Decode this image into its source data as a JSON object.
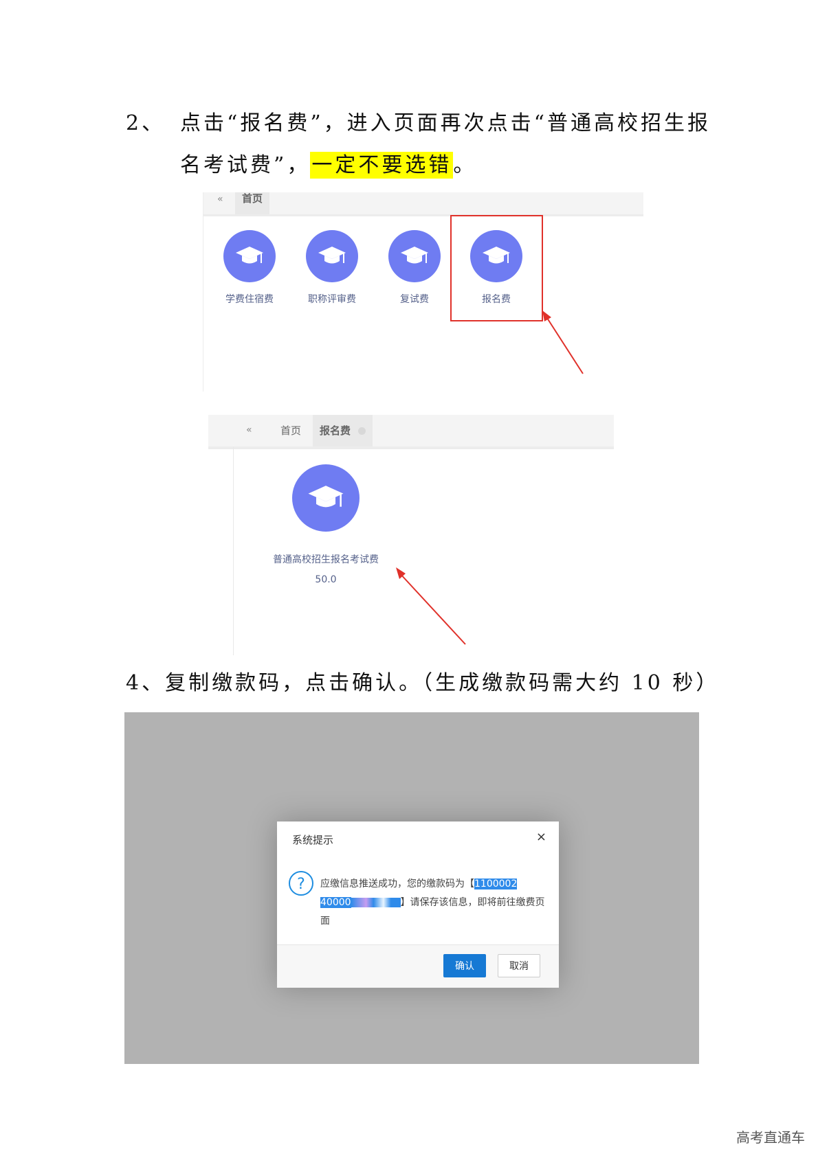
{
  "step2": {
    "number": "2、",
    "line1": "点击“报名费”，进入页面再次点击“普通高校招生报",
    "line2_prefix": "名考试费”，",
    "line2_highlight": "一定不要选错",
    "line2_suffix": "。"
  },
  "screenshot1": {
    "back_icon": "«",
    "home_tab": "首页",
    "tiles": [
      {
        "label": "学费住宿费",
        "icon": "graduation-cap-icon"
      },
      {
        "label": "职称评审费",
        "icon": "graduation-cap-icon"
      },
      {
        "label": "复试费",
        "icon": "graduation-cap-icon"
      },
      {
        "label": "报名费",
        "icon": "graduation-cap-icon"
      }
    ]
  },
  "screenshot2": {
    "back_icon": "«",
    "home_tab": "首页",
    "active_tab": "报名费",
    "tile_label": "普通高校招生报名考试费",
    "tile_amount": "50.0"
  },
  "step4": {
    "text": "4、复制缴款码，点击确认。（生成缴款码需大约 10 秒）"
  },
  "dialog": {
    "title": "系统提示",
    "close": "×",
    "icon": "?",
    "msg_part1": "应缴信息推送成功，您的缴款码为【",
    "code_part1": "1100002",
    "code_part2": "40000",
    "msg_part2": "】请保存该信息，即将前往缴费页面",
    "confirm": "确认",
    "cancel": "取消"
  },
  "colors": {
    "icon_circle": "#6f7cf2",
    "highlight": "#ffff00",
    "red_annotation": "#e0312a",
    "primary_button": "#1679d4"
  },
  "watermark": "高考直通车"
}
